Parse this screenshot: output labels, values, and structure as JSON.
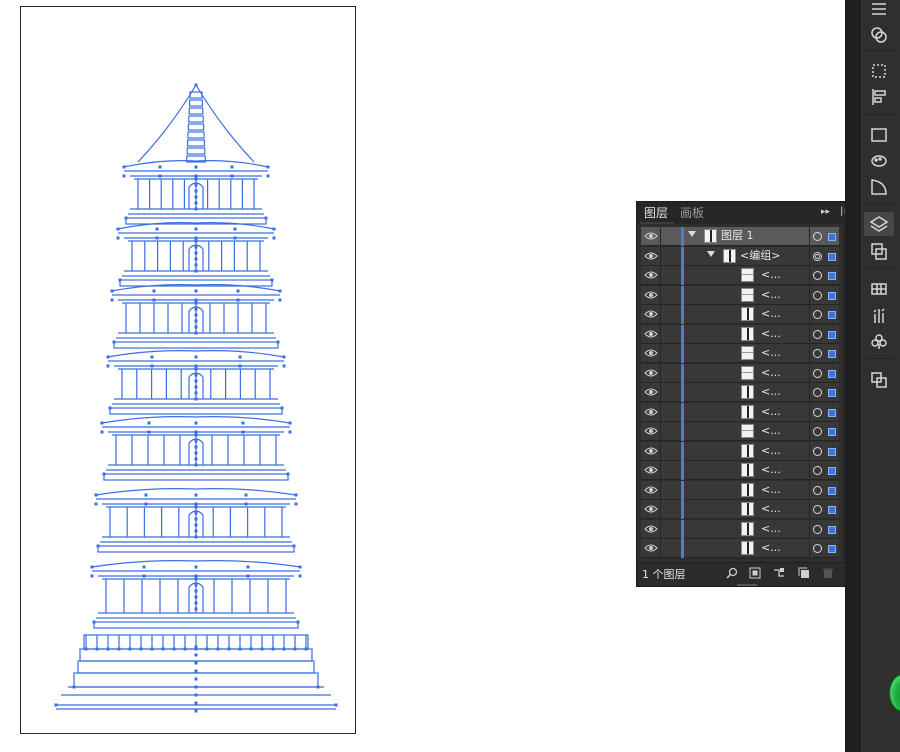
{
  "panel": {
    "tab_layers": "图层",
    "tab_artboards": "画板",
    "collapse_icon": "double-chevron-right-icon",
    "menu_icon": "panel-menu-icon",
    "footer_count": "1 个图层",
    "footer_icons": [
      "search-icon",
      "make-clipping-mask-icon",
      "create-sublayer-icon",
      "create-layer-icon",
      "delete-icon"
    ]
  },
  "layers": [
    {
      "label": "图层  1",
      "level": 0,
      "expanded": true,
      "selected": true,
      "target": "single"
    },
    {
      "label": "<编组>",
      "level": 1,
      "expanded": true,
      "selected": false,
      "target": "double"
    },
    {
      "label": "<...",
      "level": 2,
      "thumb": "hl"
    },
    {
      "label": "<...",
      "level": 2,
      "thumb": "hl"
    },
    {
      "label": "<...",
      "level": 2,
      "thumb": "tall"
    },
    {
      "label": "<...",
      "level": 2,
      "thumb": "tall"
    },
    {
      "label": "<...",
      "level": 2,
      "thumb": "hl"
    },
    {
      "label": "<...",
      "level": 2,
      "thumb": "hl"
    },
    {
      "label": "<...",
      "level": 2,
      "thumb": "tall"
    },
    {
      "label": "<...",
      "level": 2,
      "thumb": "tall"
    },
    {
      "label": "<...",
      "level": 2,
      "thumb": "hl"
    },
    {
      "label": "<...",
      "level": 2,
      "thumb": "tall"
    },
    {
      "label": "<...",
      "level": 2,
      "thumb": "tall"
    },
    {
      "label": "<...",
      "level": 2,
      "thumb": "tall"
    },
    {
      "label": "<...",
      "level": 2,
      "thumb": "tall"
    },
    {
      "label": "<...",
      "level": 2,
      "thumb": "tall"
    },
    {
      "label": "<...",
      "level": 2,
      "thumb": "tall"
    }
  ],
  "dock_icons": [
    "menu-icon",
    "appearance-icon",
    "transform-icon",
    "align-icon",
    "gradient-icon",
    "color-guide-icon",
    "transparency-icon",
    "layers-icon",
    "artboards-icon",
    "swatches-icon",
    "brushes-icon",
    "symbols-icon",
    "pathfinder-icon"
  ],
  "colors": {
    "selection": "#3c74e0",
    "layer_color": "#4f7bd1",
    "artwork_stroke": "#3b6fe0"
  }
}
